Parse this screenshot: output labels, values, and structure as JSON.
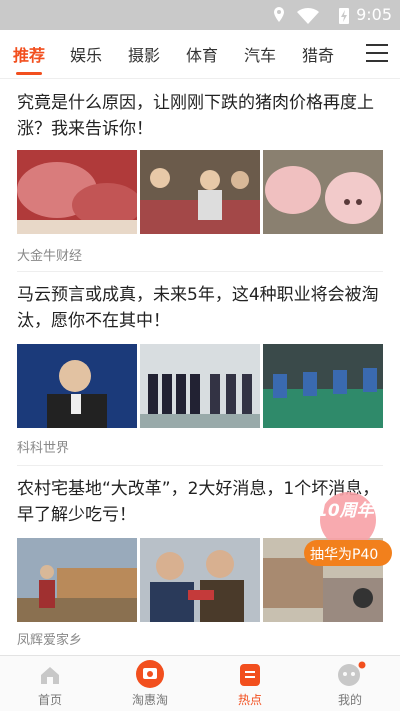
{
  "status": {
    "time": "9:05"
  },
  "tabs": [
    {
      "label": "推荐",
      "active": true
    },
    {
      "label": "娱乐",
      "active": false
    },
    {
      "label": "摄影",
      "active": false
    },
    {
      "label": "体育",
      "active": false
    },
    {
      "label": "汽车",
      "active": false
    },
    {
      "label": "猎奇",
      "active": false
    }
  ],
  "articles": [
    {
      "title": "究竟是什么原因，让刚刚下跌的猪肉价格再度上涨？我来告诉你！",
      "source": "大金牛财经"
    },
    {
      "title": "马云预言或成真，未来5年，这4种职业将会被淘汰，愿你不在其中！",
      "source": "科科世界"
    },
    {
      "title": "农村宅基地“大改革”，2大好消息，1个坏消息，早了解少吃亏！",
      "source": "凤辉爱家乡"
    }
  ],
  "promo": {
    "line1": "10周年",
    "line2": "抽华为P40"
  },
  "bottom_nav": [
    {
      "label": "首页",
      "active": false
    },
    {
      "label": "淘惠淘",
      "active": false
    },
    {
      "label": "热点",
      "active": true
    },
    {
      "label": "我的",
      "active": false
    }
  ],
  "colors": {
    "accent": "#f24f1e",
    "statusbar": "#c9c9c9"
  }
}
